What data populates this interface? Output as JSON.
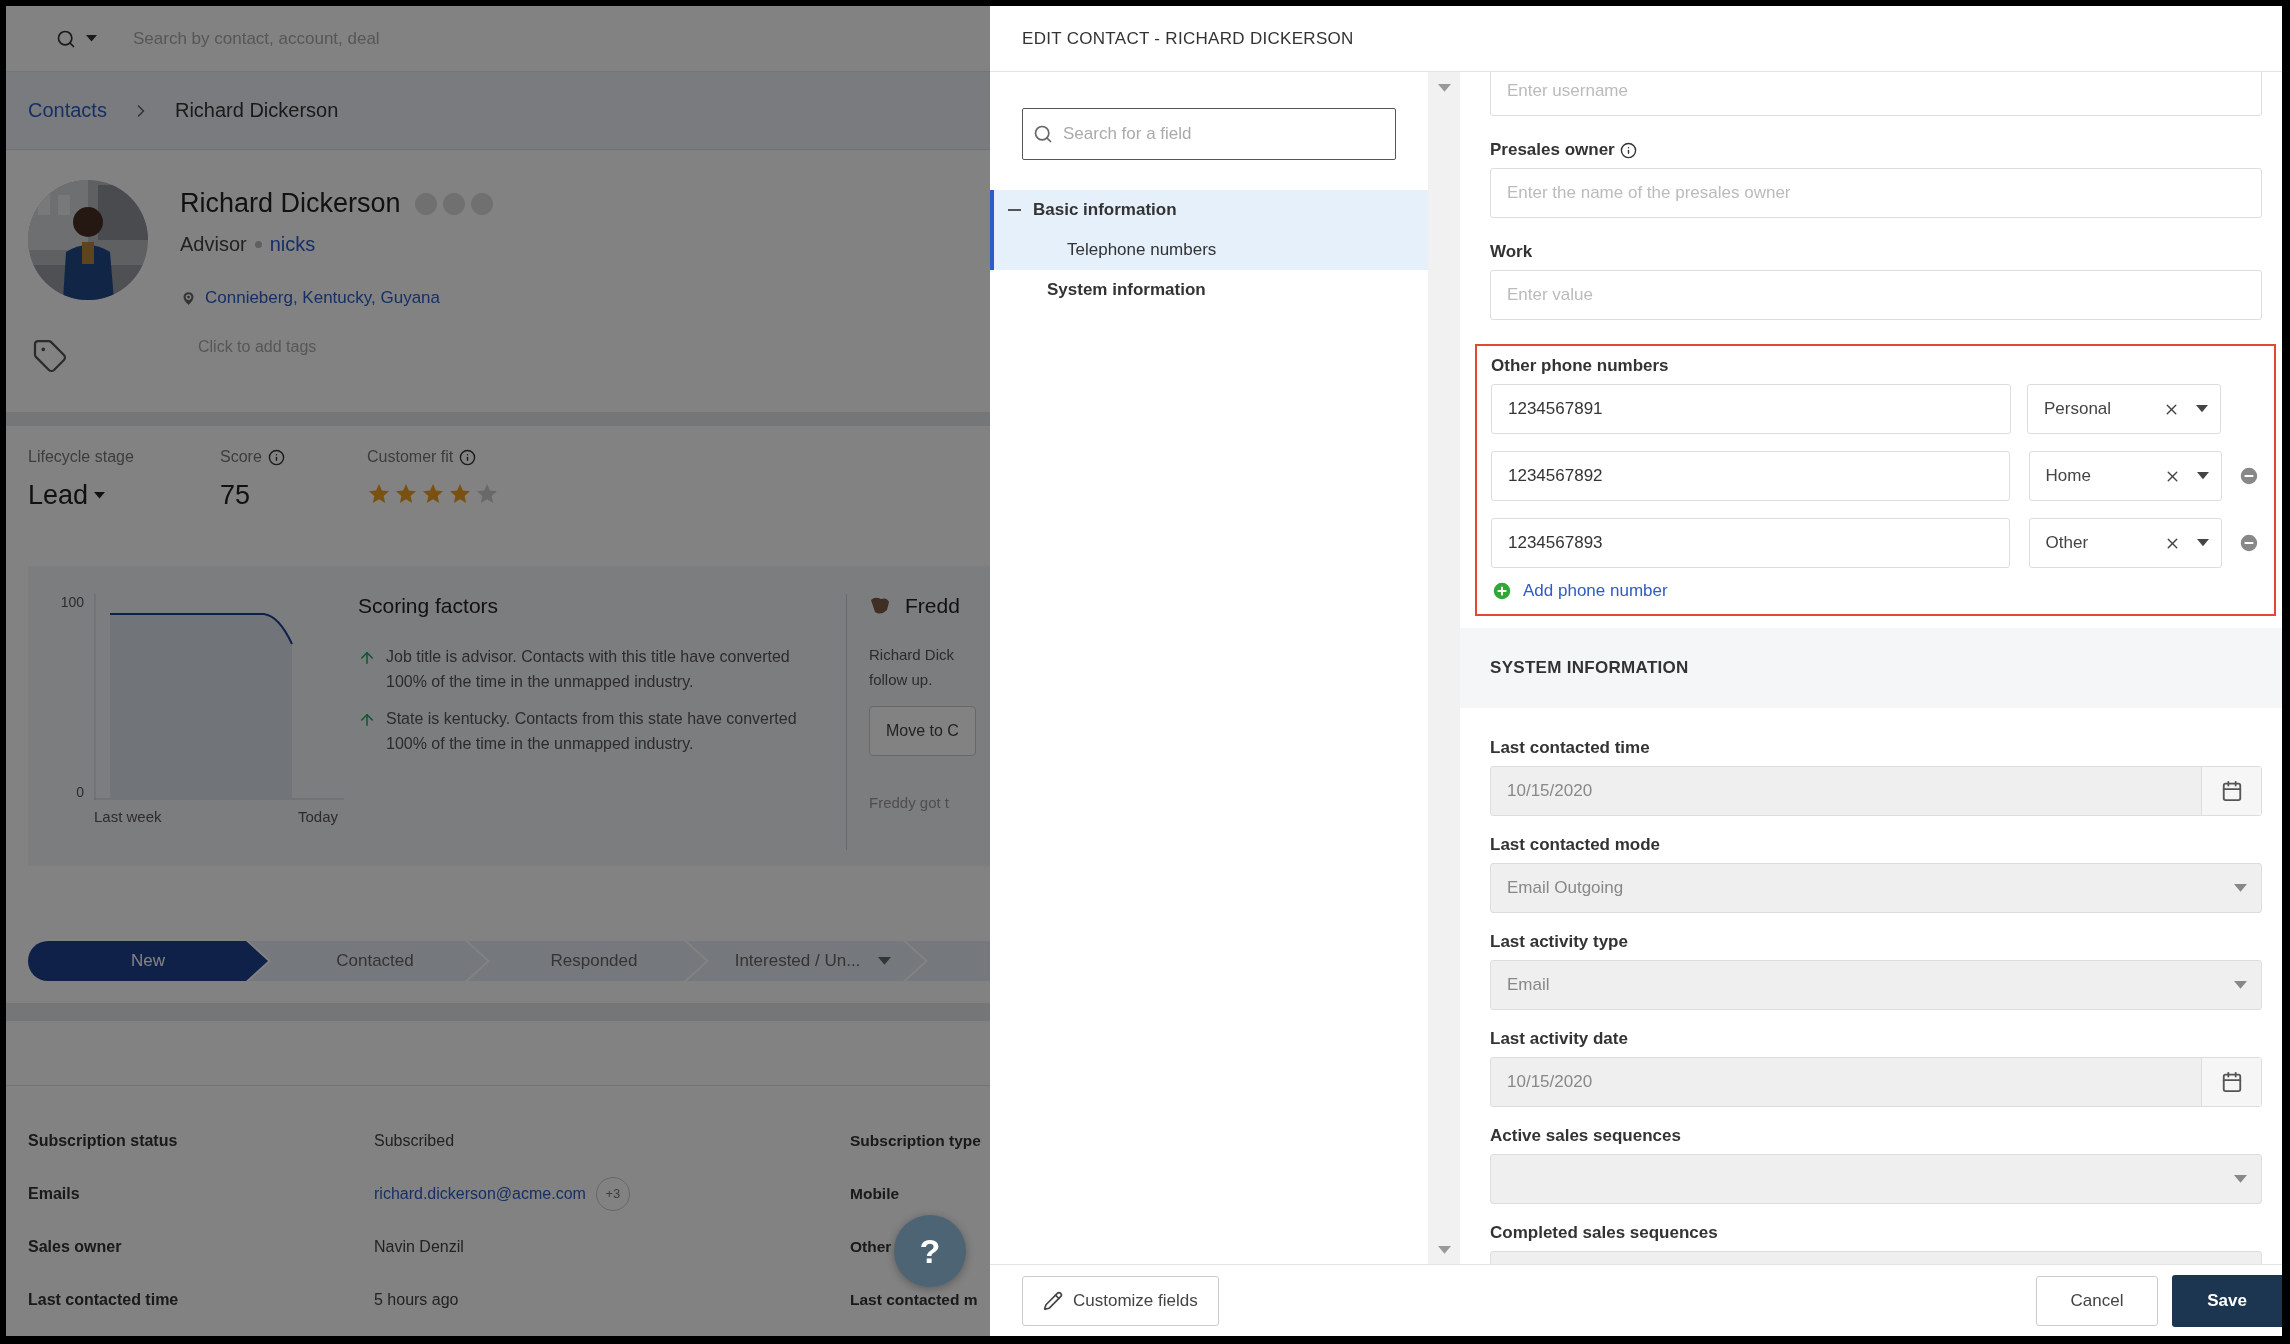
{
  "top_bar": {
    "search_placeholder": "Search by contact, account, deal"
  },
  "breadcrumb": [
    {
      "label": "Contacts",
      "kind": "link"
    },
    {
      "label": "Richard Dickerson",
      "kind": "current"
    }
  ],
  "profile": {
    "name": "Richard Dickerson",
    "title": "Advisor",
    "company": "nicks",
    "location": "Connieberg, Kentucky, Guyana",
    "tags_placeholder": "Click to add tags"
  },
  "metrics": {
    "lifecycle": {
      "label": "Lifecycle stage",
      "value": "Lead"
    },
    "score": {
      "label": "Score",
      "value": "75"
    },
    "customer_fit": {
      "label": "Customer fit",
      "stars": 4
    }
  },
  "score_chart": {
    "y_labels": [
      "100",
      "0"
    ],
    "x_labels": [
      "Last week",
      "Today"
    ]
  },
  "scoring_factors": {
    "title": "Scoring factors",
    "items": [
      "Job title is advisor. Contacts with this title have converted 100% of the time in the unmapped industry.",
      "State is kentucky. Contacts from this state have converted 100% of the time in the unmapped industry."
    ]
  },
  "freddy": {
    "title": "Fredd",
    "lines": [
      "Richard Dick",
      "follow up."
    ],
    "button": "Move to C",
    "footer": "Freddy got t"
  },
  "pipeline": [
    {
      "label": "New",
      "selected": true,
      "kind": "stage"
    },
    {
      "label": "Contacted",
      "selected": false,
      "kind": "stage"
    },
    {
      "label": "Responded",
      "selected": false,
      "kind": "stage"
    },
    {
      "label": "Interested / Un...",
      "selected": false,
      "kind": "dropdown"
    },
    {
      "selected": false,
      "kind": "stub"
    }
  ],
  "details": [
    {
      "label": "Subscription status",
      "value": "Subscribed",
      "kind": "text",
      "side_label": "Subscription type"
    },
    {
      "label": "Emails",
      "value": "richard.dickerson@acme.com",
      "kind": "link",
      "badge": "+3",
      "side_label": "Mobile"
    },
    {
      "label": "Sales owner",
      "value": "Navin Denzil",
      "kind": "text",
      "side_label": "Other"
    },
    {
      "label": "Last contacted time",
      "value": "5 hours ago",
      "kind": "text",
      "side_label": "Last contacted m"
    }
  ],
  "help_button": "?",
  "edit_panel": {
    "title": "EDIT CONTACT - RICHARD DICKERSON",
    "field_search": {
      "placeholder": "Search for a field"
    },
    "nav": [
      {
        "label": "Basic information",
        "selected": true,
        "expanded": true,
        "children": [
          {
            "label": "Telephone numbers"
          }
        ]
      },
      {
        "label": "System information",
        "selected": false
      }
    ],
    "fields": [
      {
        "kind": "text",
        "placeholder": "Enter username"
      },
      {
        "kind": "text",
        "label": "Presales owner",
        "info": true,
        "placeholder": "Enter the name of the presales owner"
      },
      {
        "kind": "text",
        "label": "Work",
        "placeholder": "Enter value"
      },
      {
        "kind": "phones",
        "label": "Other phone numbers",
        "highlighted": true,
        "add_label": "Add phone number",
        "rows": [
          {
            "number": "1234567891",
            "type": "Personal",
            "removable": false
          },
          {
            "number": "1234567892",
            "type": "Home",
            "removable": true
          },
          {
            "number": "1234567893",
            "type": "Other",
            "removable": true
          }
        ]
      },
      {
        "kind": "section",
        "label": "SYSTEM INFORMATION"
      },
      {
        "kind": "date",
        "label": "Last contacted time",
        "value": "10/15/2020",
        "disabled": true
      },
      {
        "kind": "select",
        "label": "Last contacted mode",
        "value": "Email Outgoing",
        "disabled": true
      },
      {
        "kind": "select",
        "label": "Last activity type",
        "value": "Email",
        "disabled": true
      },
      {
        "kind": "date",
        "label": "Last activity date",
        "value": "10/15/2020",
        "disabled": true
      },
      {
        "kind": "select",
        "label": "Active sales sequences",
        "disabled": true
      },
      {
        "kind": "select",
        "label": "Completed sales sequences",
        "disabled": true
      }
    ],
    "footer": {
      "customize": "Customize fields",
      "cancel": "Cancel",
      "save": "Save"
    }
  }
}
